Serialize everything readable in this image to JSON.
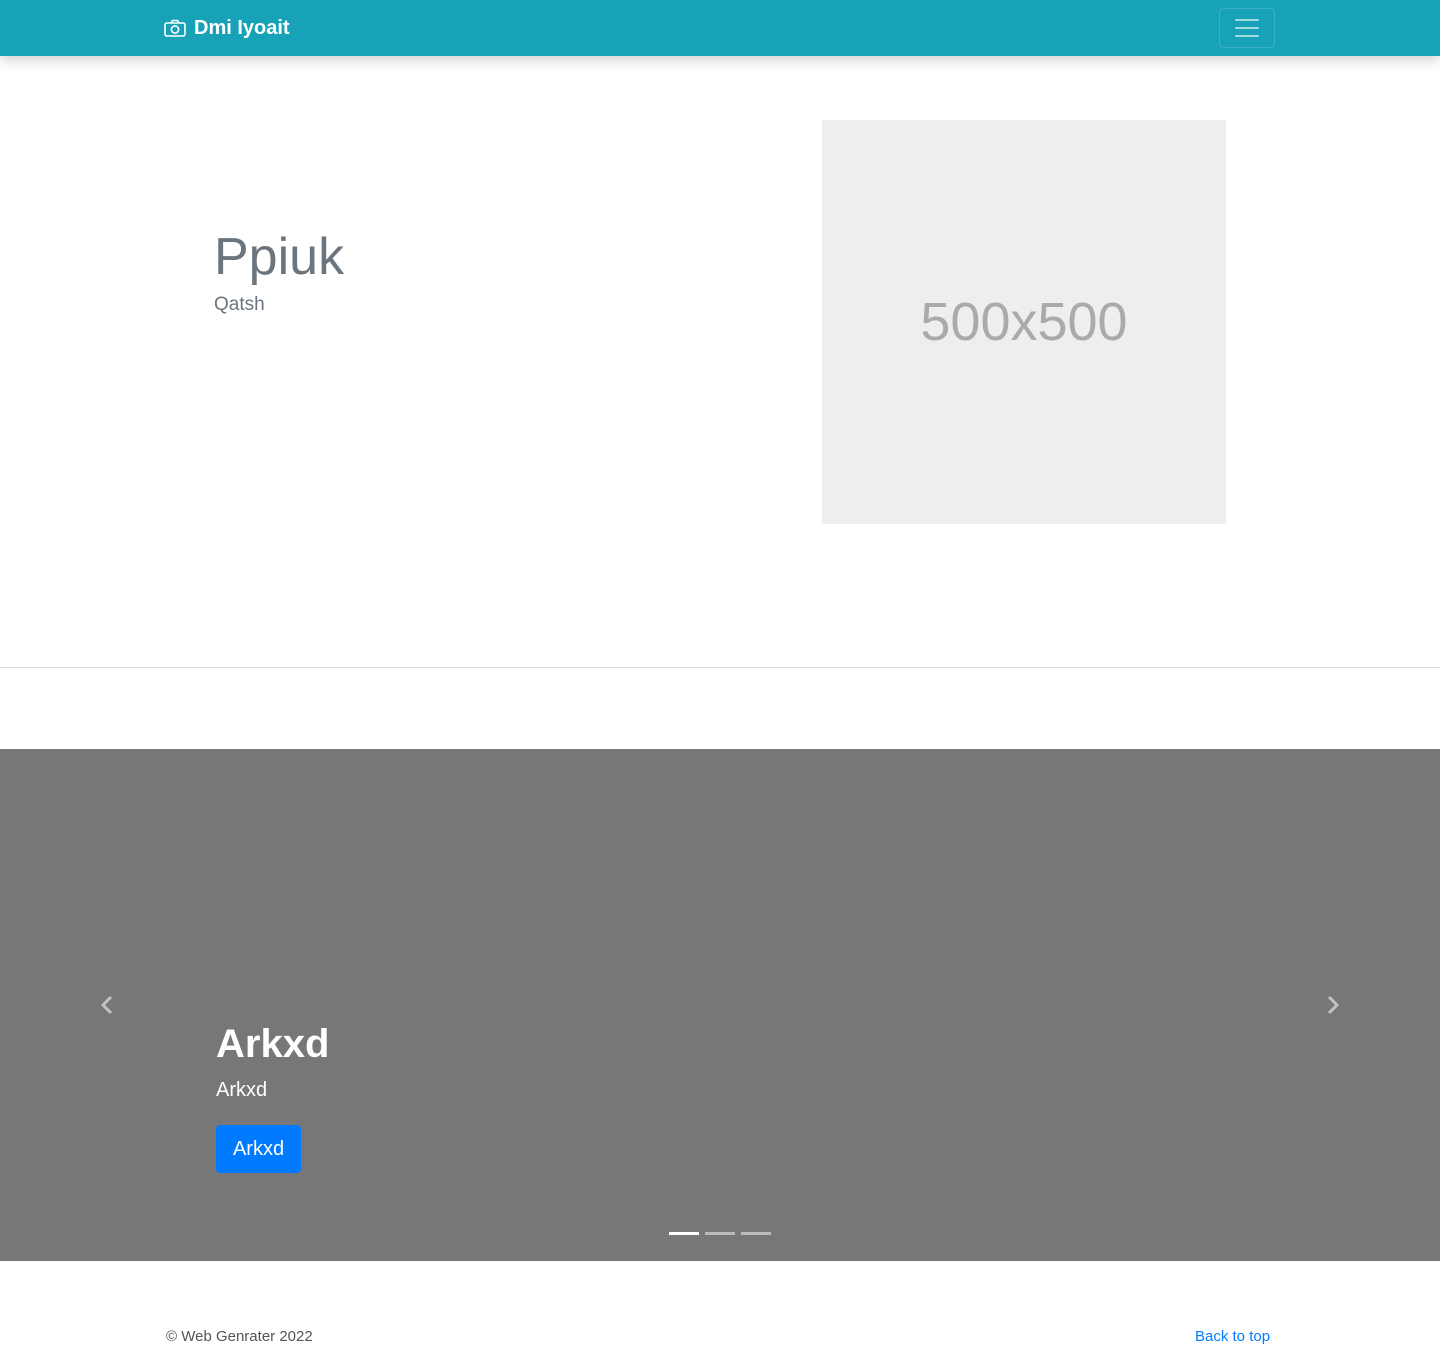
{
  "navbar": {
    "brand": "Dmi Iyoait",
    "brand_icon": "camera-icon",
    "toggler_icon": "hamburger-icon",
    "background": "#17a2b8"
  },
  "hero": {
    "title": "Ppiuk",
    "subtitle": "Qatsh",
    "image_placeholder": "500x500"
  },
  "carousel": {
    "slide": {
      "title": "Arkxd",
      "text": "Arkxd",
      "button_label": "Arkxd"
    },
    "indicator_count": 3,
    "active_index": 0,
    "prev_icon": "chevron-left-icon",
    "next_icon": "chevron-right-icon"
  },
  "footer": {
    "copyright": "© Web Genrater 2022",
    "back_to_top": "Back to top"
  },
  "colors": {
    "accent": "#17a2b8",
    "primary_button": "#007bff",
    "carousel_bg": "#777777"
  }
}
